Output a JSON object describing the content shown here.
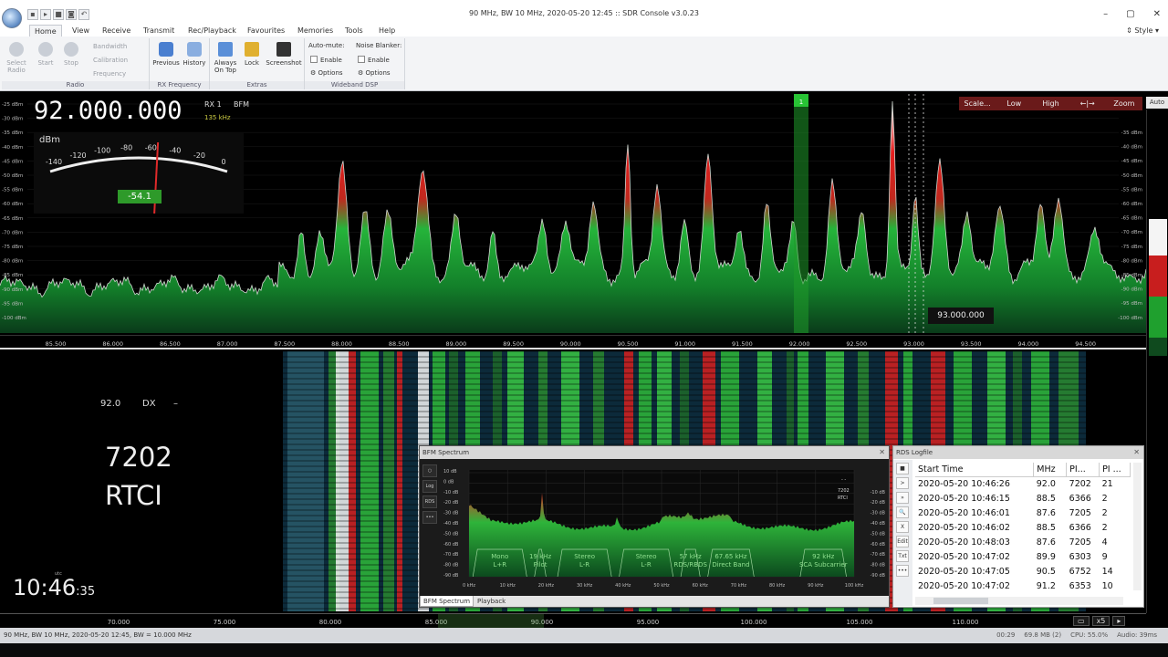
{
  "window": {
    "title": "90 MHz, BW 10 MHz, 2020-05-20 12:45 :: SDR Console v3.0.23",
    "min_glyph": "–",
    "max_glyph": "▢",
    "close_glyph": "✕"
  },
  "ribbon_tabs": [
    "Home",
    "View",
    "Receive",
    "Transmit",
    "Rec/Playback",
    "Favourites",
    "Memories",
    "Tools",
    "Help"
  ],
  "style_label": "Style",
  "ribbon": {
    "radio": {
      "select_radio": "Select Radio",
      "start": "Start",
      "stop": "Stop",
      "bandwidth": "Bandwidth",
      "calibration": "Calibration",
      "frequency": "Frequency",
      "label": "Radio"
    },
    "rx_frequency": {
      "previous": "Previous",
      "history": "History",
      "label": "RX Frequency"
    },
    "extras": {
      "always_on_top": "Always On Top",
      "lock": "Lock",
      "screenshot": "Screenshot",
      "label": "Extras"
    },
    "wideband_dsp": {
      "auto_mute": "Auto-mute:",
      "noise_blanker": "Noise Blanker:",
      "enable": "Enable",
      "options": "Options",
      "label": "Wideband DSP"
    }
  },
  "receiver": {
    "frequency": "92.000.000",
    "rx": "RX 1",
    "mode": "BFM",
    "bandwidth": "135 kHz",
    "smeter_unit": "dBm",
    "smeter_scale": [
      "-140",
      "-120",
      "-100",
      "-80",
      "-60",
      "-40",
      "-20",
      "0"
    ],
    "smeter_value": "-54.1",
    "smeter_dbm": -54.1
  },
  "scale_buttons": [
    "Scale...",
    "Low",
    "High",
    "←|→",
    "Zoom"
  ],
  "auto_label": "Auto",
  "spectrum": {
    "db_left": [
      "-25 dBm",
      "-30 dBm",
      "-35 dBm",
      "-40 dBm",
      "-45 dBm",
      "-50 dBm",
      "-55 dBm",
      "-60 dBm",
      "-65 dBm",
      "-70 dBm",
      "-75 dBm",
      "-80 dBm",
      "-85 dBm",
      "-90 dBm",
      "-95 dBm",
      "-100 dBm"
    ],
    "db_right": [
      "-35 dBm",
      "-40 dBm",
      "-45 dBm",
      "-50 dBm",
      "-55 dBm",
      "-60 dBm",
      "-65 dBm",
      "-70 dBm",
      "-75 dBm",
      "-80 dBm",
      "-85 dBm",
      "-90 dBm",
      "-95 dBm",
      "-100 dBm"
    ],
    "freq_ticks": [
      "85.500",
      "86.000",
      "86.500",
      "87.000",
      "87.500",
      "88.000",
      "88.500",
      "89.000",
      "89.500",
      "90.000",
      "90.500",
      "91.000",
      "91.500",
      "92.000",
      "92.500",
      "93.000",
      "93.500",
      "94.000",
      "94.500"
    ],
    "tooltip": "93.000.000",
    "vfo_marker": "1"
  },
  "rds": {
    "freq": "92.0",
    "dx": "DX",
    "dash": "–",
    "pi": "7202",
    "ps": "RTCI"
  },
  "clock": {
    "utc": "utc",
    "hm": "10:46",
    "sec": ":35"
  },
  "bfm_panel": {
    "title": "BFM Spectrum",
    "close": "✕",
    "side_buttons": [
      "○",
      "Log",
      "RDS",
      "•••"
    ],
    "db_labels": [
      "10 dB",
      "0 dB",
      "-10 dB",
      "-20 dB",
      "-30 dB",
      "-40 dB",
      "-50 dB",
      "-60 dB",
      "-70 dB",
      "-80 dB",
      "-90 dB"
    ],
    "db_right": [
      "-10 dB",
      "-20 dB",
      "-30 dB",
      "-40 dB",
      "-50 dB",
      "-60 dB",
      "-70 dB",
      "-80 dB",
      "-90 dB"
    ],
    "khz_ticks": [
      "0 kHz",
      "10 kHz",
      "20 kHz",
      "30 kHz",
      "40 kHz",
      "50 kHz",
      "60 kHz",
      "70 kHz",
      "80 kHz",
      "90 kHz",
      "100 kHz"
    ],
    "bands": {
      "mono": [
        "Mono",
        "L+R"
      ],
      "pilot": [
        "19 kHz",
        "Pilot"
      ],
      "stereo1": [
        "Stereo",
        "L-R"
      ],
      "stereo2": [
        "Stereo",
        "L-R"
      ],
      "rds": [
        "57 kHz",
        "RDS/RBDS"
      ],
      "direct": [
        "67.65 kHz",
        "Direct Band"
      ],
      "sca": [
        "92 kHz",
        "SCA Subcarrier"
      ]
    },
    "mini_rds": [
      "- -",
      "7202",
      "RTCI"
    ],
    "tabs": [
      "BFM Spectrum",
      "Playback"
    ]
  },
  "logfile": {
    "title": "RDS Logfile",
    "close": "✕",
    "side_buttons": [
      "■",
      ">",
      "»",
      "🔍",
      "X",
      "Edit",
      "Txt",
      "•••"
    ],
    "columns": [
      "Start Time",
      "MHz",
      "PI...",
      "PI ..."
    ],
    "rows": [
      [
        "2020-05-20 10:46:26",
        "92.0",
        "7202",
        "21"
      ],
      [
        "2020-05-20 10:46:15",
        "88.5",
        "6366",
        "2"
      ],
      [
        "2020-05-20 10:46:01",
        "87.6",
        "7205",
        "2"
      ],
      [
        "2020-05-20 10:46:02",
        "88.5",
        "6366",
        "2"
      ],
      [
        "2020-05-20 10:48:03",
        "87.6",
        "7205",
        "4"
      ],
      [
        "2020-05-20 10:47:02",
        "89.9",
        "6303",
        "9"
      ],
      [
        "2020-05-20 10:47:05",
        "90.5",
        "6752",
        "14"
      ],
      [
        "2020-05-20 10:47:02",
        "91.2",
        "6353",
        "10"
      ]
    ]
  },
  "band_scale": [
    "70.000",
    "75.000",
    "80.000",
    "85.000",
    "90.000",
    "95.000",
    "100.000",
    "105.000",
    "110.000"
  ],
  "band_zoom": "x5",
  "status": {
    "left": "90 MHz, BW 10 MHz, 2020-05-20 12:45, BW = 10.000 MHz",
    "time": "00:29",
    "memory": "69.8 MB (2)",
    "cpu": "CPU: 55.0%",
    "audio": "Audio: 39ms"
  },
  "colors": {
    "spectrum_green": "#1a8a2a",
    "spectrum_red": "#d42020",
    "vfo_green": "#1f9a2a",
    "scale_bar": "#6a1a1a"
  }
}
